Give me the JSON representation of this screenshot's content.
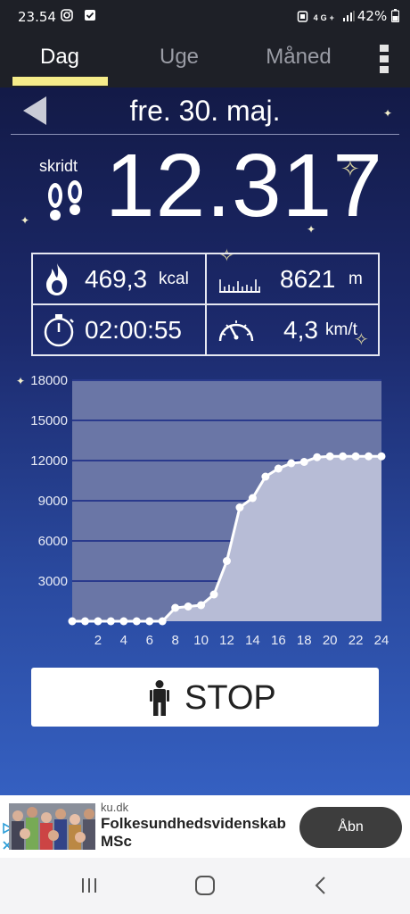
{
  "status": {
    "time": "23.54",
    "left_icons": [
      "instagram-icon",
      "check-icon"
    ],
    "right_icons": [
      "alarm-icon",
      "4g-icon",
      "signal-icon"
    ],
    "battery": "42%"
  },
  "tabs": [
    {
      "label": "Dag",
      "active": true
    },
    {
      "label": "Uge",
      "active": false
    },
    {
      "label": "Måned",
      "active": false
    }
  ],
  "date": "fre. 30. maj.",
  "steps": {
    "label": "skridt",
    "value": "12.317"
  },
  "stats": {
    "calories": {
      "value": "469,3",
      "unit": "kcal",
      "icon": "flame-icon"
    },
    "distance": {
      "value": "8621",
      "unit": "m",
      "icon": "ruler-icon"
    },
    "duration": {
      "value": "02:00:55",
      "icon": "stopwatch-icon"
    },
    "speed": {
      "value": "4,3",
      "unit": "km/t",
      "icon": "speedometer-icon"
    }
  },
  "chart_data": {
    "type": "area",
    "x": [
      0,
      1,
      2,
      3,
      4,
      5,
      6,
      7,
      8,
      9,
      10,
      11,
      12,
      13,
      14,
      15,
      16,
      17,
      18,
      19,
      20,
      21,
      22,
      23,
      24
    ],
    "values": [
      0,
      0,
      0,
      0,
      0,
      0,
      0,
      0,
      1000,
      1100,
      1200,
      2000,
      4500,
      8500,
      9200,
      10800,
      11400,
      11800,
      11900,
      12250,
      12317,
      12317,
      12317,
      12317,
      12317
    ],
    "x_ticks": [
      "2",
      "4",
      "6",
      "8",
      "10",
      "12",
      "14",
      "16",
      "18",
      "20",
      "22",
      "24"
    ],
    "y_ticks": [
      "3000",
      "6000",
      "9000",
      "12000",
      "15000",
      "18000"
    ],
    "xlim": [
      0,
      24
    ],
    "ylim": [
      0,
      18000
    ],
    "grid": true,
    "colors": {
      "area": "#b7bcd6",
      "plot_bg": "#6a76a6",
      "line": "#ffffff",
      "grid": "#2a3a8c"
    }
  },
  "stop_button": {
    "label": "STOP",
    "icon": "person-icon"
  },
  "ad": {
    "source": "ku.dk",
    "title_line1": "Folkesundhedsvidenskab",
    "title_line2": "MSc",
    "cta": "Åbn"
  },
  "nav": {
    "buttons": [
      "recent-apps-icon",
      "home-icon",
      "back-icon"
    ]
  }
}
